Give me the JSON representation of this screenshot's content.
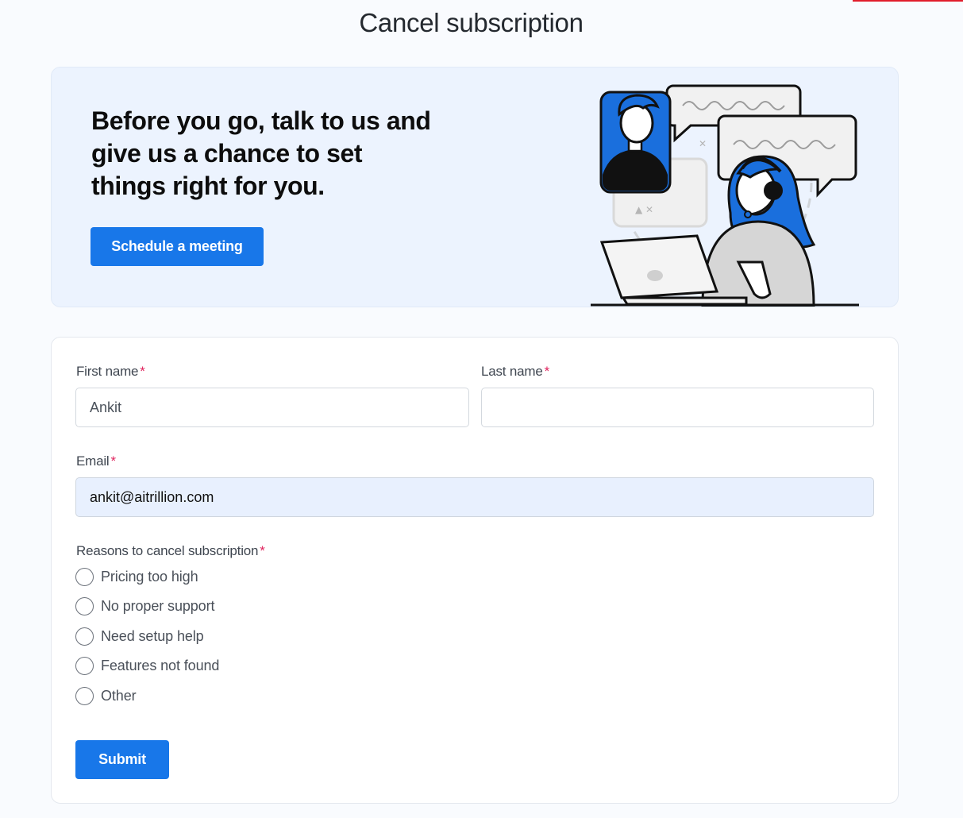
{
  "page": {
    "title": "Cancel subscription"
  },
  "hero": {
    "heading": "Before you go, talk to us and give us a chance to set things right for you.",
    "schedule_label": "Schedule a meeting"
  },
  "form": {
    "first_name": {
      "label": "First name",
      "required_mark": "*",
      "value": "Ankit"
    },
    "last_name": {
      "label": "Last name",
      "required_mark": "*",
      "value": ""
    },
    "email": {
      "label": "Email",
      "required_mark": "*",
      "value": "ankit@aitrillion.com"
    },
    "reasons": {
      "label": "Reasons to cancel subscription",
      "required_mark": "*",
      "options": [
        {
          "label": "Pricing too high"
        },
        {
          "label": "No proper support"
        },
        {
          "label": "Need setup help"
        },
        {
          "label": "Features not found"
        },
        {
          "label": "Other"
        }
      ]
    },
    "submit_label": "Submit"
  },
  "colors": {
    "primary": "#1877e9",
    "required": "#e0245e",
    "hero_bg": "#ecf3fe",
    "autofill_bg": "#e8f0fe",
    "accent_line": "#e11d2b"
  },
  "icons": [
    "support-agent-illustration",
    "radio-unchecked-icon"
  ]
}
